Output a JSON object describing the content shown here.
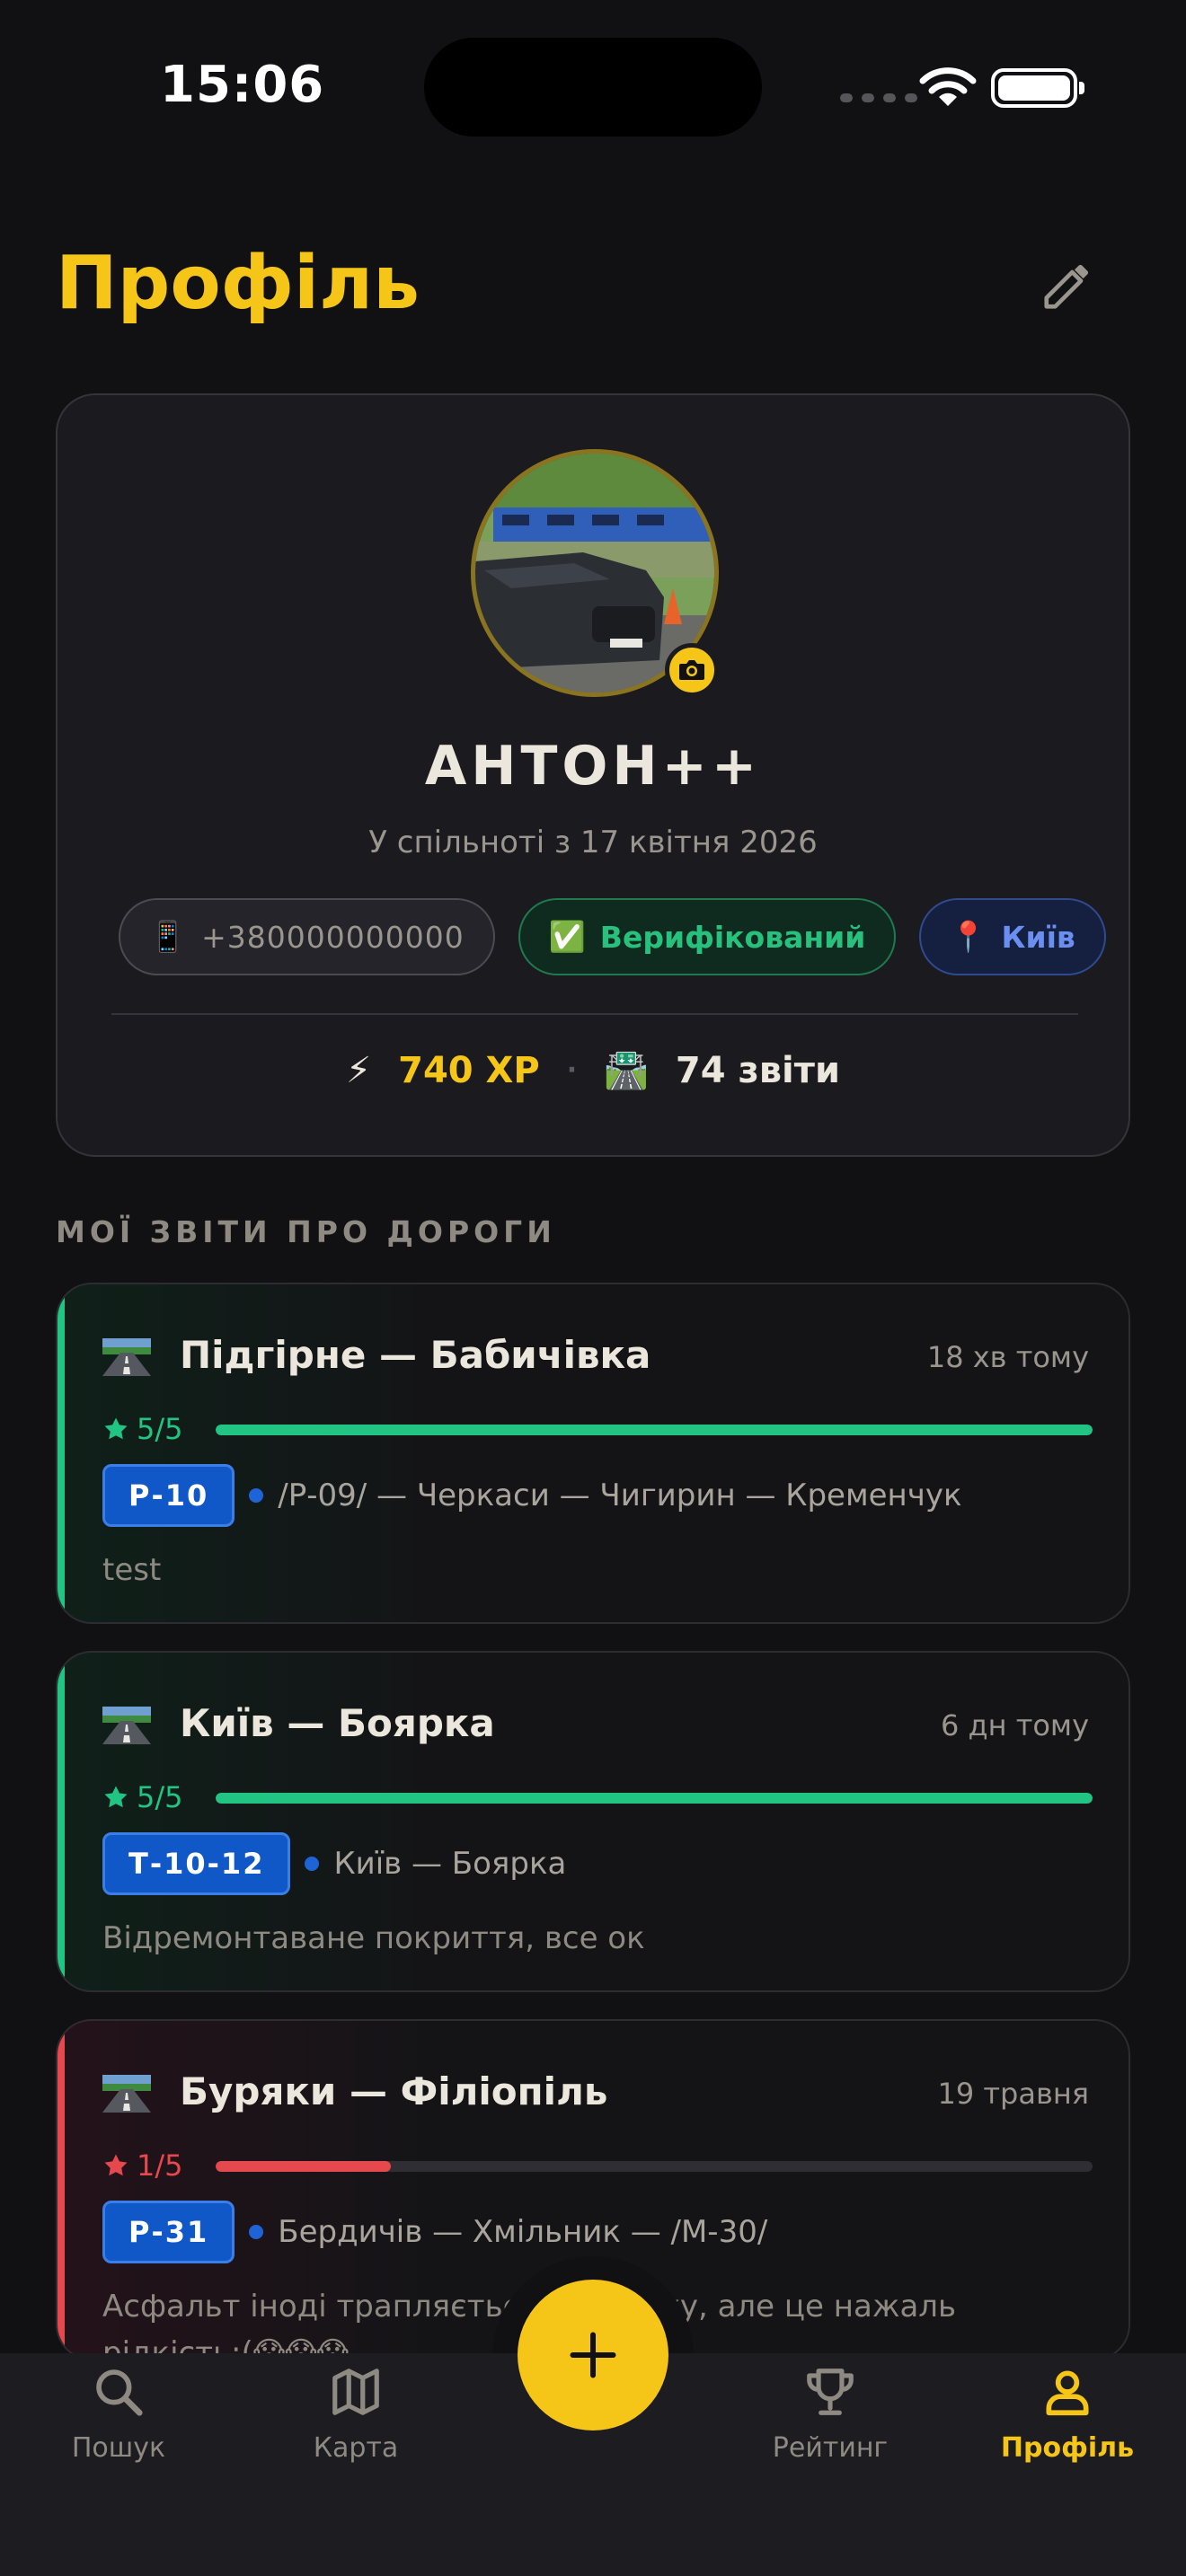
{
  "status_bar": {
    "time": "15:06"
  },
  "header": {
    "title": "Профіль",
    "edit_icon": "pencil-icon"
  },
  "profile": {
    "name": "АНТОН++",
    "member_since": "У спільноті з 17 квітня 2026",
    "phone_icon": "📱",
    "phone": "+380000000000",
    "verified_icon": "✅",
    "verified_label": "Верифікований",
    "city_icon": "📍",
    "city": "Київ",
    "xp_icon": "⚡",
    "xp": "740 XP",
    "separator": "·",
    "reports_icon": "🛣️",
    "reports": "74 звіти"
  },
  "reports_section": {
    "title": "МОЇ ЗВІТИ ПРО ДОРОГИ",
    "items": [
      {
        "icon": "road-icon",
        "title": "Підгірне — Бабичівка",
        "time": "18 хв тому",
        "rating": "5/5",
        "rating_value": 5,
        "road": "Р-10",
        "route": "/Р-09/ — Черкаси — Чигирин — Кременчук",
        "comment": "test",
        "color": "#22C483"
      },
      {
        "icon": "road-icon",
        "title": "Київ — Боярка",
        "time": "6 дн тому",
        "rating": "5/5",
        "rating_value": 5,
        "road": "Т-10-12",
        "route": "Київ — Боярка",
        "comment": "Відремонтаване покриття, все ок",
        "color": "#22C483"
      },
      {
        "icon": "road-icon",
        "title": "Буряки — Філіопіль",
        "time": "19 травня",
        "rating": "1/5",
        "rating_value": 1,
        "road": "Р-31",
        "route": "Бердичів — Хмільник — /М-30/",
        "comment": "Асфальт іноді трапляється на шляху, але це нажаль рідкість:(😱😱😱",
        "color": "#E5484D"
      }
    ]
  },
  "tab_bar": {
    "search": "Пошук",
    "map": "Карта",
    "rating": "Рейтинг",
    "profile": "Профіль",
    "add": "+"
  },
  "colors": {
    "accent": "#F5C518",
    "good": "#22C483",
    "bad": "#E5484D",
    "road_badge": "#1057C7"
  }
}
